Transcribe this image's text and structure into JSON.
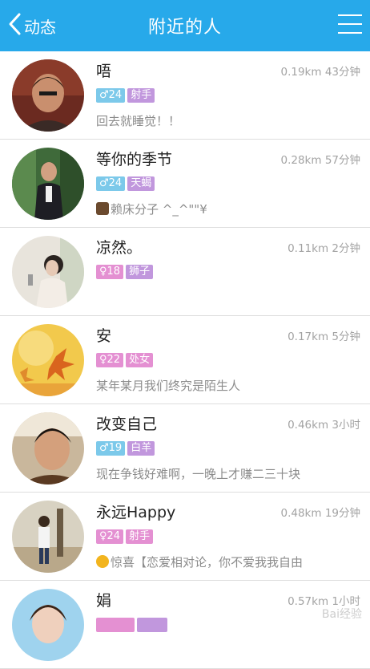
{
  "header": {
    "back_label": "动态",
    "title": "附近的人",
    "accent": "#27a9ea"
  },
  "colors": {
    "male_badge": "#7cc9ea",
    "female_badge": "#e490d2",
    "sign_badge": "#c197dd"
  },
  "users": [
    {
      "name": "唔",
      "distance": "0.19km",
      "time": "43分钟",
      "gender_icon": "male-icon",
      "age": "24",
      "sign": "射手",
      "status": "回去就睡觉！！",
      "status_icon": ""
    },
    {
      "name": "等你的季节",
      "distance": "0.28km",
      "time": "57分钟",
      "gender_icon": "male-icon",
      "age": "24",
      "sign": "天蝎",
      "status": "赖床分子 ^_^\"\"¥",
      "status_icon": "face-icon"
    },
    {
      "name": "凉然。",
      "distance": "0.11km",
      "time": "2分钟",
      "gender_icon": "female-icon",
      "age": "18",
      "sign": "狮子",
      "status": "",
      "status_icon": ""
    },
    {
      "name": "安",
      "distance": "0.17km",
      "time": "5分钟",
      "gender_icon": "female-icon",
      "age": "22",
      "sign": "处女",
      "status": "某年某月我们终究是陌生人",
      "status_icon": ""
    },
    {
      "name": "改变自己",
      "distance": "0.46km",
      "time": "3小时",
      "gender_icon": "male-icon",
      "age": "19",
      "sign": "白羊",
      "status": "现在争钱好难啊，一晚上才赚二三十块",
      "status_icon": ""
    },
    {
      "name": "永远Happy",
      "distance": "0.48km",
      "time": "19分钟",
      "gender_icon": "female-icon",
      "age": "24",
      "sign": "射手",
      "status": "惊喜【恋爱相对论，你不爱我我自由",
      "status_icon": "smile-icon"
    },
    {
      "name": "娟",
      "distance": "0.57km",
      "time": "1小时",
      "gender_icon": "female-icon",
      "age": "",
      "sign": "",
      "status": "",
      "status_icon": ""
    }
  ],
  "watermark": "Bai经验"
}
